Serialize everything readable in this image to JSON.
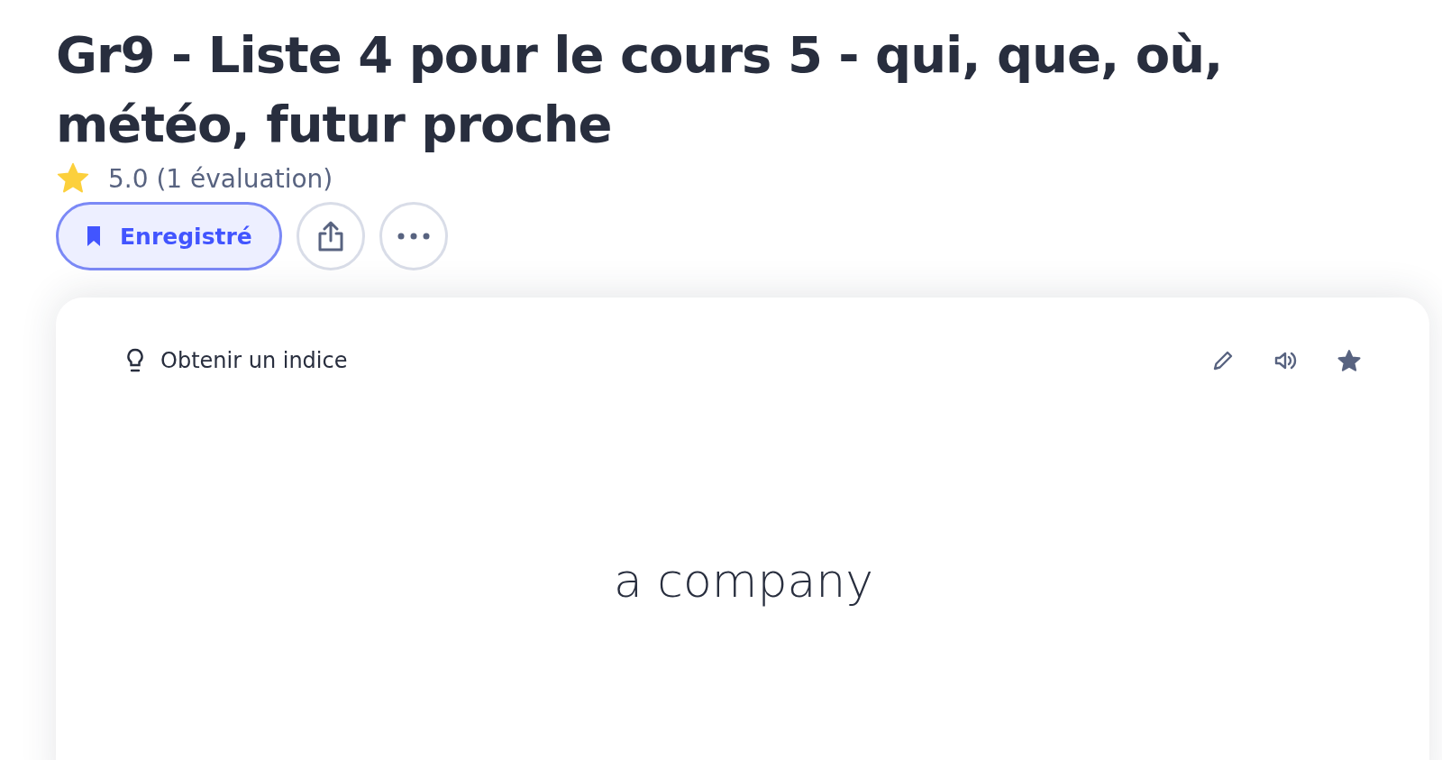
{
  "title": "Gr9 - Liste 4 pour le cours 5 - qui, que, où, météo, futur proche",
  "rating": {
    "text": "5.0 (1 évaluation)"
  },
  "actions": {
    "save": {
      "label": "Enregistré",
      "saved": true
    }
  },
  "card": {
    "hint": "Obtenir un indice",
    "starred": true,
    "term": "a company"
  }
}
